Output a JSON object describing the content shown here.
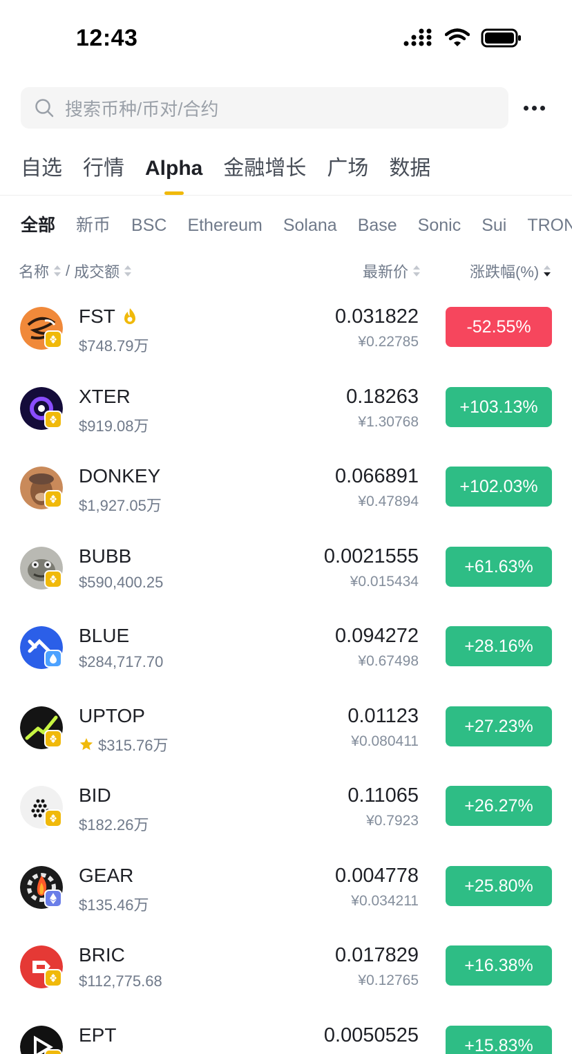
{
  "status_bar": {
    "time": "12:43"
  },
  "search": {
    "placeholder": "搜索币种/币对/合约"
  },
  "main_tabs": [
    "自选",
    "行情",
    "Alpha",
    "金融增长",
    "广场",
    "数据"
  ],
  "active_main_tab": "Alpha",
  "sub_tabs": [
    "全部",
    "新币",
    "BSC",
    "Ethereum",
    "Solana",
    "Base",
    "Sonic",
    "Sui",
    "TRON"
  ],
  "active_sub_tab": "全部",
  "headers": {
    "name": "名称",
    "slash": "/",
    "volume": "成交额",
    "price": "最新价",
    "change": "涨跌幅(%)"
  },
  "coins": [
    {
      "symbol": "FST",
      "volume": "$748.79万",
      "price": "0.031822",
      "cny": "¥0.22785",
      "change": "-52.55%",
      "direction": "down",
      "chain": "bsc",
      "hot": true,
      "logo": "fst-logo"
    },
    {
      "symbol": "XTER",
      "volume": "$919.08万",
      "price": "0.18263",
      "cny": "¥1.30768",
      "change": "+103.13%",
      "direction": "up",
      "chain": "bsc",
      "logo": "xter-logo"
    },
    {
      "symbol": "DONKEY",
      "volume": "$1,927.05万",
      "price": "0.066891",
      "cny": "¥0.47894",
      "change": "+102.03%",
      "direction": "up",
      "chain": "bsc",
      "logo": "donkey-logo"
    },
    {
      "symbol": "BUBB",
      "volume": "$590,400.25",
      "price": "0.0021555",
      "cny": "¥0.015434",
      "change": "+61.63%",
      "direction": "up",
      "chain": "bsc",
      "logo": "bubb-logo"
    },
    {
      "symbol": "BLUE",
      "volume": "$284,717.70",
      "price": "0.094272",
      "cny": "¥0.67498",
      "change": "+28.16%",
      "direction": "up",
      "chain": "sui",
      "logo": "blue-logo"
    },
    {
      "symbol": "UPTOP",
      "volume": "$315.76万",
      "price": "0.01123",
      "cny": "¥0.080411",
      "change": "+27.23%",
      "direction": "up",
      "chain": "bsc",
      "starred": true,
      "logo": "uptop-logo"
    },
    {
      "symbol": "BID",
      "volume": "$182.26万",
      "price": "0.11065",
      "cny": "¥0.7923",
      "change": "+26.27%",
      "direction": "up",
      "chain": "bsc",
      "logo": "bid-logo"
    },
    {
      "symbol": "GEAR",
      "volume": "$135.46万",
      "price": "0.004778",
      "cny": "¥0.034211",
      "change": "+25.80%",
      "direction": "up",
      "chain": "ethereum",
      "logo": "gear-logo"
    },
    {
      "symbol": "BRIC",
      "volume": "$112,775.68",
      "price": "0.017829",
      "cny": "¥0.12765",
      "change": "+16.38%",
      "direction": "up",
      "chain": "bsc",
      "logo": "bric-logo"
    },
    {
      "symbol": "EPT",
      "volume": "",
      "price": "0.0050525",
      "cny": "",
      "change": "+15.83%",
      "direction": "up",
      "chain": "bsc",
      "logo": "ept-logo"
    }
  ],
  "colors": {
    "accent": "#f0b90b",
    "up": "#2ebd85",
    "down": "#f6465d"
  }
}
